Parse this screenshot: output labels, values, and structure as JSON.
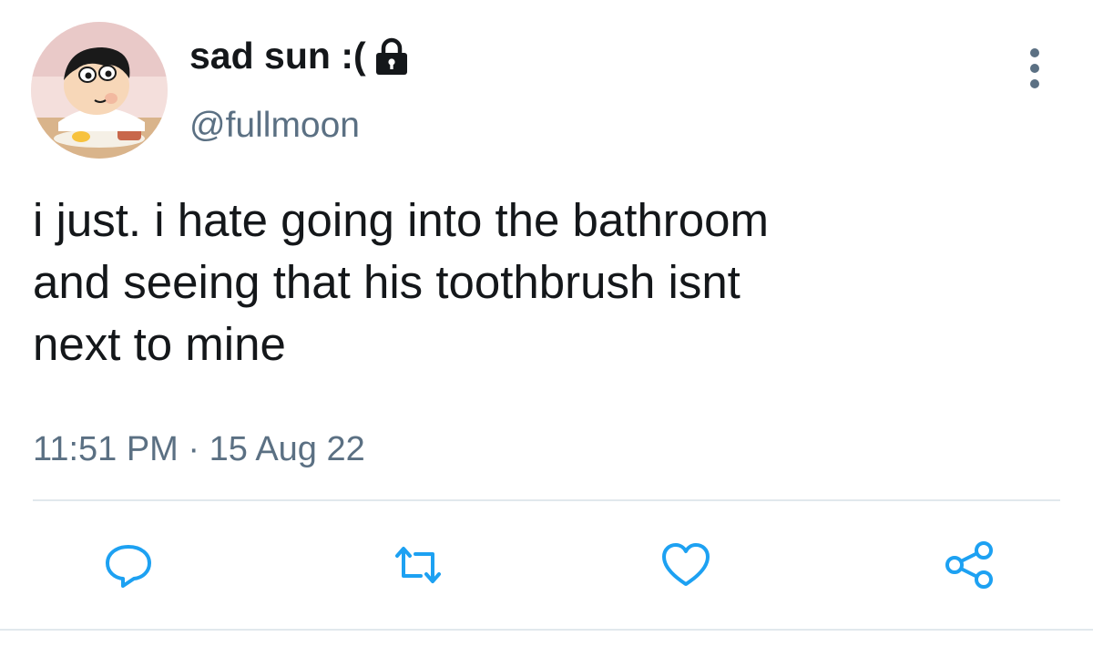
{
  "tweet": {
    "display_name": "sad sun :(",
    "protected_icon": "lock-icon",
    "handle": "@fullmoon",
    "text_lines": [
      "i just. i hate going into the bathroom",
      "and seeing that his toothbrush isnt",
      "next to mine"
    ],
    "timestamp": "11:51 PM · 15 Aug 22"
  },
  "actions": [
    {
      "name": "reply",
      "icon": "reply-icon"
    },
    {
      "name": "retweet",
      "icon": "retweet-icon"
    },
    {
      "name": "like",
      "icon": "heart-icon"
    },
    {
      "name": "share",
      "icon": "share-icon"
    }
  ],
  "colors": {
    "text": "#14171a",
    "secondary": "#5b7083",
    "icon": "#1da1f2",
    "divider": "#e1e8ed"
  }
}
